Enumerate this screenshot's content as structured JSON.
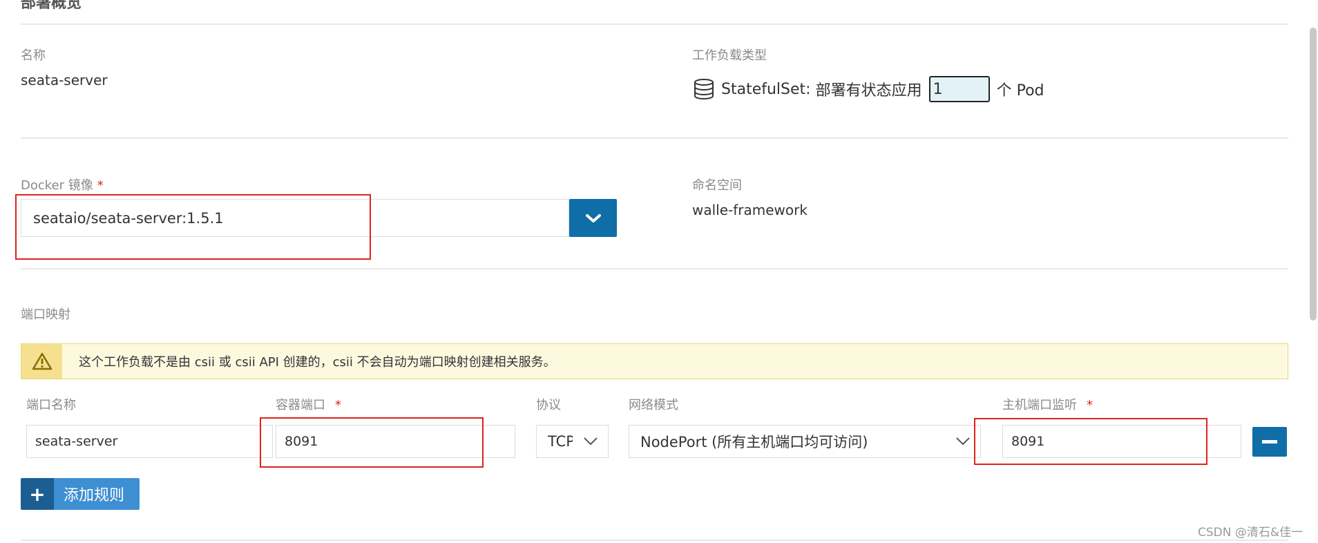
{
  "section_title": "部署概览",
  "name": {
    "label": "名称",
    "value": "seata-server"
  },
  "workload_type": {
    "label": "工作负载类型",
    "kind": "StatefulSet",
    "description": "部署有状态应用",
    "scale_value": "1",
    "scale_suffix": "个 Pod",
    "icon": "database-icon"
  },
  "docker_image": {
    "label": "Docker 镜像",
    "required_mark": "*",
    "value": "seataio/seata-server:1.5.1",
    "dropdown_icon": "chevron-down-icon"
  },
  "namespace": {
    "label": "命名空间",
    "value": "walle-framework"
  },
  "port_mapping": {
    "label": "端口映射",
    "warning": "这个工作负载不是由 csii 或 csii API 创建的，csii 不会自动为端口映射创建相关服务。",
    "columns": {
      "port_name": "端口名称",
      "container_port": "容器端口",
      "protocol": "协议",
      "network_mode": "网络模式",
      "host_port": "主机端口监听"
    },
    "required_mark": "*",
    "row": {
      "port_name": "seata-server",
      "container_port": "8091",
      "protocol": "TCP",
      "network_mode": "NodePort (所有主机端口均可访问)",
      "host_port": "8091"
    },
    "add_rule_label": "添加规则"
  },
  "watermark": "CSDN @清石&佳一",
  "colors": {
    "primary": "#0f6ea8",
    "highlight": "#e0211b",
    "warning_bg": "#fdf9df"
  }
}
